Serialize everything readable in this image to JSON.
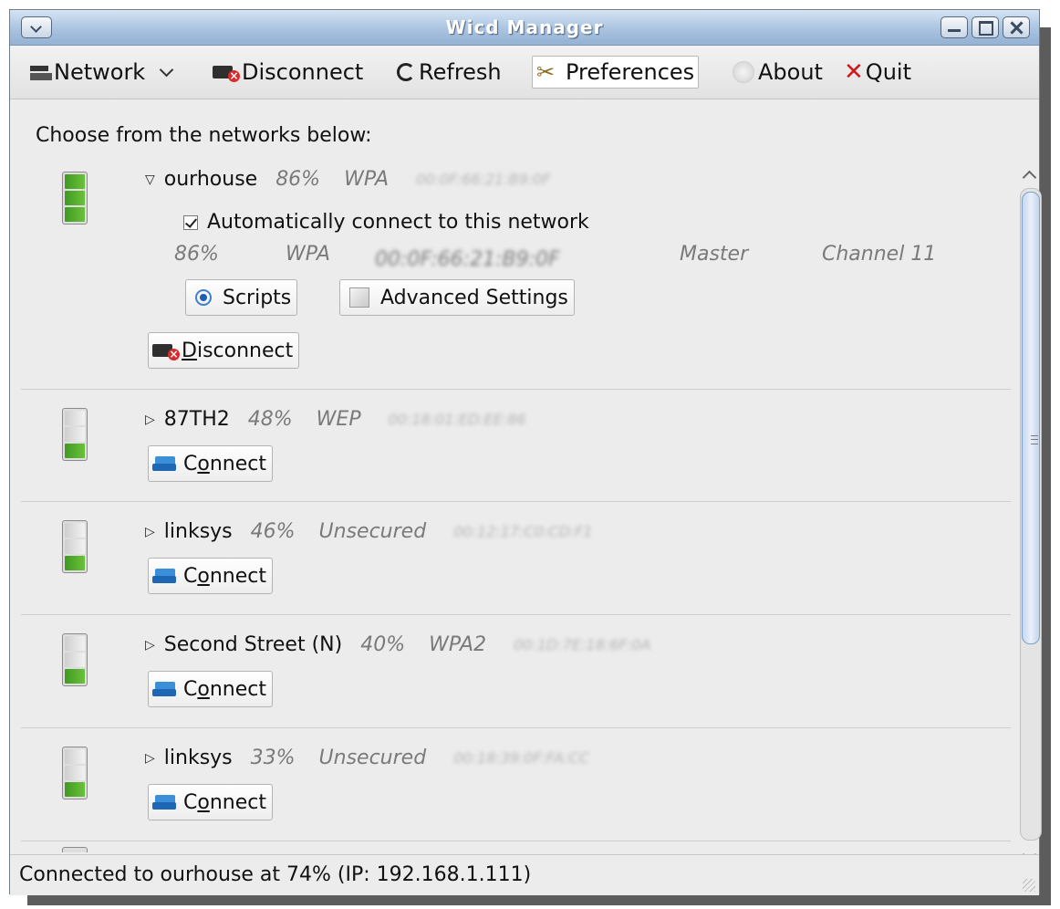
{
  "window": {
    "title": "Wicd Manager"
  },
  "toolbar": {
    "network_label": "Network",
    "disconnect_label": "Disconnect",
    "refresh_label": "Refresh",
    "preferences_label": "Preferences",
    "about_label": "About",
    "quit_label": "Quit"
  },
  "heading": "Choose from the networks below:",
  "networks": [
    {
      "name": "ourhouse",
      "strength": "86%",
      "encryption": "WPA",
      "bssid": "00:0F:66:21:B9:0F",
      "expanded": true,
      "signal_level": 0.86,
      "auto_connect_label": "Automatically connect to this network",
      "auto_connect_checked": true,
      "detail_strength": "86%",
      "detail_encryption": "WPA",
      "detail_bssid": "00:0F:66:21:B9:0F",
      "mode": "Master",
      "channel": "Channel 11",
      "scripts_label": "Scripts",
      "advanced_label": "Advanced Settings",
      "action_prefix": "",
      "action_accel": "D",
      "action_suffix": "isconnect"
    },
    {
      "name": "87TH2",
      "strength": "48%",
      "encryption": "WEP",
      "bssid": "00:18:01:ED:EE:86",
      "expanded": false,
      "signal_level": 0.48,
      "action_prefix": "C",
      "action_accel": "o",
      "action_suffix": "nnect"
    },
    {
      "name": "linksys",
      "strength": "46%",
      "encryption": "Unsecured",
      "bssid": "00:12:17:C0:CD:F1",
      "expanded": false,
      "signal_level": 0.46,
      "action_prefix": "C",
      "action_accel": "o",
      "action_suffix": "nnect"
    },
    {
      "name": "Second Street (N)",
      "strength": "40%",
      "encryption": "WPA2",
      "bssid": "00:1D:7E:18:6F:0A",
      "expanded": false,
      "signal_level": 0.4,
      "action_prefix": "C",
      "action_accel": "o",
      "action_suffix": "nnect"
    },
    {
      "name": "linksys",
      "strength": "33%",
      "encryption": "Unsecured",
      "bssid": "00:18:39:0F:FA:CC",
      "expanded": false,
      "signal_level": 0.33,
      "action_prefix": "C",
      "action_accel": "o",
      "action_suffix": "nnect"
    }
  ],
  "status": "Connected to ourhouse at 74% (IP: 192.168.1.111)",
  "colors": {
    "signal_fill": "#6cc13a",
    "signal_fill_dark": "#3f9a22",
    "signal_empty": "#dedede",
    "titlebar": "#a9c3e0"
  }
}
